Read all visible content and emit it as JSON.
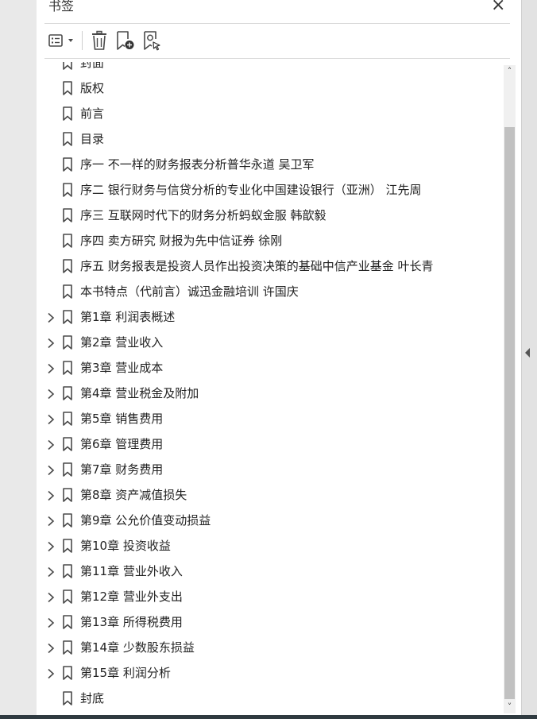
{
  "panel": {
    "title": "书签",
    "close_symbol": "×"
  },
  "toolbar": {
    "icons": [
      "options-menu-icon",
      "delete-bookmark-icon",
      "new-bookmark-icon",
      "bookmark-search-icon"
    ]
  },
  "bookmarks": [
    {
      "label": "封面",
      "expandable": false
    },
    {
      "label": "版权",
      "expandable": false
    },
    {
      "label": "前言",
      "expandable": false
    },
    {
      "label": "目录",
      "expandable": false
    },
    {
      "label": "序一  不一样的财务报表分析普华永道  吴卫军",
      "expandable": false
    },
    {
      "label": "序二  银行财务与信贷分析的专业化中国建设银行（亚洲）  江先周",
      "expandable": false
    },
    {
      "label": "序三  互联网时代下的财务分析蚂蚁金服  韩歆毅",
      "expandable": false
    },
    {
      "label": "序四  卖方研究  财报为先中信证券  徐刚",
      "expandable": false
    },
    {
      "label": "序五  财务报表是投资人员作出投资决策的基础中信产业基金  叶长青",
      "expandable": false
    },
    {
      "label": "本书特点（代前言）诚迅金融培训  许国庆",
      "expandable": false
    },
    {
      "label": "第1章  利润表概述",
      "expandable": true
    },
    {
      "label": "第2章  营业收入",
      "expandable": true
    },
    {
      "label": "第3章  营业成本",
      "expandable": true
    },
    {
      "label": "第4章  营业税金及附加",
      "expandable": true
    },
    {
      "label": "第5章  销售费用",
      "expandable": true
    },
    {
      "label": "第6章  管理费用",
      "expandable": true
    },
    {
      "label": "第7章  财务费用",
      "expandable": true
    },
    {
      "label": "第8章  资产减值损失",
      "expandable": true
    },
    {
      "label": "第9章  公允价值变动损益",
      "expandable": true
    },
    {
      "label": "第10章  投资收益",
      "expandable": true
    },
    {
      "label": "第11章  营业外收入",
      "expandable": true
    },
    {
      "label": "第12章  营业外支出",
      "expandable": true
    },
    {
      "label": "第13章  所得税费用",
      "expandable": true
    },
    {
      "label": "第14章  少数股东损益",
      "expandable": true
    },
    {
      "label": "第15章  利润分析",
      "expandable": true
    },
    {
      "label": "封底",
      "expandable": false
    }
  ],
  "scrollbar": {
    "up_symbol": "˄",
    "down_symbol": "˅"
  },
  "colors": {
    "icon": "#4a4a4a",
    "accent_plus": "#333333",
    "text": "#222222"
  }
}
